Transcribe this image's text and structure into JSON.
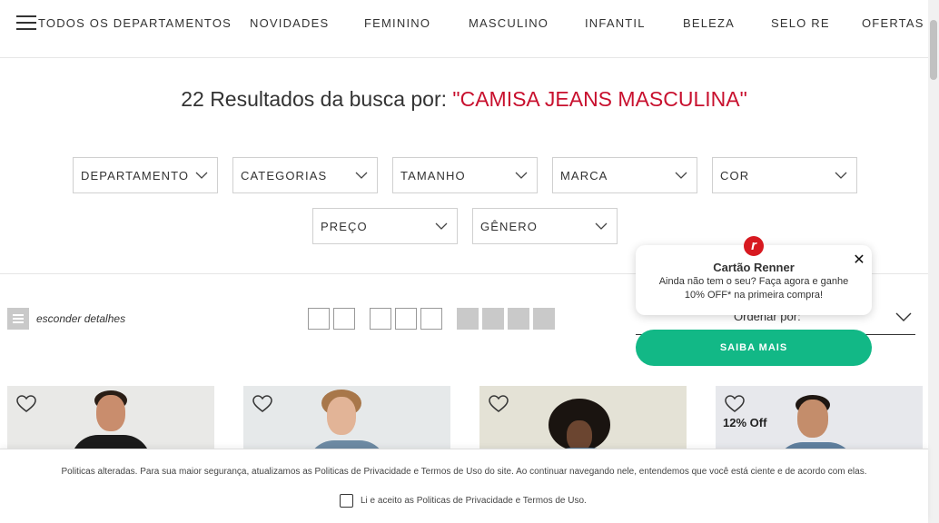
{
  "nav": {
    "all_departments": "TODOS OS DEPARTAMENTOS",
    "items": [
      "NOVIDADES",
      "FEMININO",
      "MASCULINO",
      "INFANTIL",
      "BELEZA",
      "SELO RE",
      "OFERTAS"
    ]
  },
  "search": {
    "results_prefix": "22 Resultados da busca por: ",
    "query": "\"CAMISA JEANS MASCULINA\""
  },
  "filters": [
    "DEPARTAMENTO",
    "CATEGORIAS",
    "TAMANHO",
    "MARCA",
    "COR",
    "PREÇO",
    "GÊNERO"
  ],
  "toolbar": {
    "details_label": "esconder detalhes",
    "sort_label": "Ordenar por:"
  },
  "popup": {
    "logo_letter": "r",
    "title": "Cartão Renner",
    "text": "Ainda não tem o seu? Faça agora e ganhe 10% OFF* na primeira compra!",
    "close_glyph": "✕",
    "cta": "SAIBA MAIS"
  },
  "products": [
    {
      "badge": ""
    },
    {
      "badge": ""
    },
    {
      "badge": ""
    },
    {
      "badge": "12% Off"
    }
  ],
  "cookie": {
    "text": "Politicas alteradas. Para sua maior segurança, atualizamos as Politicas de Privacidade e Termos de Uso do site. Ao continuar navegando nele, entendemos que você está ciente e de acordo com elas.",
    "checkbox_label": "Li e aceito as Politicas de Privacidade e Termos de Uso."
  },
  "colors": {
    "accent_red": "#c8102e",
    "cta_green": "#12b886"
  }
}
